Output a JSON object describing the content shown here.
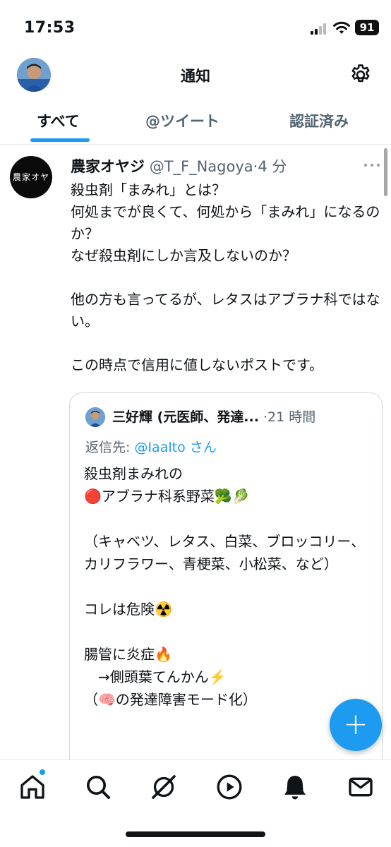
{
  "status_bar": {
    "time": "17:53",
    "battery": "91"
  },
  "header": {
    "title": "通知"
  },
  "tabs": [
    {
      "label": "すべて",
      "active": true
    },
    {
      "label": "@ツイート",
      "active": false
    },
    {
      "label": "認証済み",
      "active": false
    }
  ],
  "tweet": {
    "avatar_text": "農家オヤジ",
    "name": "農家オヤジ",
    "handle": "@T_F_Nagoya",
    "separator": "·",
    "time_ago": "4 分",
    "lines": [
      "殺虫剤「まみれ」とは？\n何処までが良くて、何処から「まみれ」になるのか？\nなぜ殺虫剤にしか言及しないのか？",
      "他の方も言ってるが、レタスはアブラナ科ではない。",
      "この時点で信用に値しないポストです。"
    ]
  },
  "quote": {
    "name": "三好輝 (元医師、発達...",
    "separator": "·",
    "time_ago": "21 時間",
    "reply_prefix": "返信先: ",
    "reply_mention": "@Iaalto さん",
    "lines": [
      "殺虫剤まみれの\n🔴アブラナ科系野菜🥦🥬",
      "（キャベツ、レタス、白菜、ブロッコリー、カリフラワー、青梗菜、小松菜、など）",
      "コレは危険☢️",
      "腸管に炎症🔥\n　→側頭葉てんかん⚡️\n（🧠の発達障害モード化）"
    ]
  },
  "fab": {
    "label": "+"
  },
  "bottom_nav": {
    "items": [
      "home-icon",
      "search-icon",
      "grok-icon",
      "video-icon",
      "notifications-icon",
      "messages-icon"
    ],
    "accent": "#1d9bf0"
  },
  "colors": {
    "accent": "#1d9bf0",
    "text": "#0f1419",
    "secondary": "#536471"
  }
}
